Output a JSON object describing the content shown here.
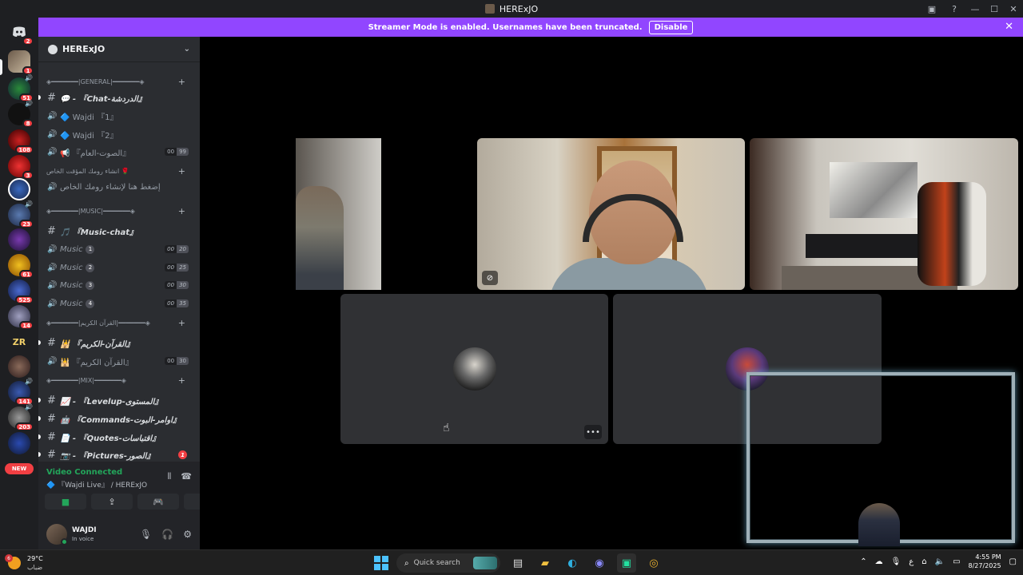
{
  "window": {
    "title": "HERExJO"
  },
  "banner": {
    "text": "Streamer Mode is enabled. Usernames have been truncated.",
    "disable_label": "Disable"
  },
  "rail": {
    "badges": [
      "2",
      "1",
      "51",
      "8",
      "108",
      "3",
      "23",
      "61",
      "525",
      "14",
      "141",
      "203"
    ],
    "zr_label": "ZR",
    "new_label": "NEW"
  },
  "guild": {
    "name": "HERExJO"
  },
  "categories": {
    "general": "◈━━━━━━━|GENERAL|━━━━━━━◈",
    "private": "انشاء رومك المؤقت الخاص 🌹",
    "music": "◈━━━━━━━|MUSIC|━━━━━━━◈",
    "quran": "◈━━━━━━━|القرآن الكريم|━━━━━━━◈",
    "mix": "◈━━━━━━━|MIX|━━━━━━━◈"
  },
  "channels": {
    "chat": "💬 - 『Chat-الدردشة』",
    "wajdi1": "🔷 Wajdi 『1』",
    "wajdi2": "🔷 Wajdi 『2』",
    "sawt": "📢 『الصوت-العام』",
    "sawt_limit": [
      "00",
      "99"
    ],
    "private_create": "إضغط هنا لإنشاء رومك الخاص",
    "music_chat": "🎵 『Music-chat』",
    "music_label": "Music",
    "music_nums": [
      "1",
      "2",
      "3",
      "4"
    ],
    "music_limits": [
      [
        "00",
        "20"
      ],
      [
        "00",
        "25"
      ],
      [
        "00",
        "30"
      ],
      [
        "00",
        "35"
      ]
    ],
    "quran_text": "🕌 『القرآن-الكريم』",
    "quran_voice": "🕌 『القرآن الكريم』",
    "quran_limit": [
      "00",
      "30"
    ],
    "levelup": "📈 - 『Levelup-المستوى』",
    "commands": "🤖 『Commands-اوامر-البوت』",
    "quotes": "📄 - 『Quotes-اقتباسات』",
    "pictures": "📷 - 『Pictures-الصور』",
    "pictures_mentions": "1"
  },
  "voice_panel": {
    "status": "Video Connected",
    "channel": "🔷 『Wajdi Live』",
    "server": "/ HERExJO"
  },
  "user": {
    "name": "WAJDI",
    "status": "In voice"
  },
  "taskbar": {
    "temp": "29°C",
    "condition": "ضباب",
    "weather_badge": "6",
    "search_placeholder": "Quick search",
    "lang": "ع",
    "time": "4:55 PM",
    "date": "8/27/2025"
  },
  "colors": {
    "brand": "#9146ff",
    "online": "#23a55a",
    "badge": "#f23f43"
  }
}
